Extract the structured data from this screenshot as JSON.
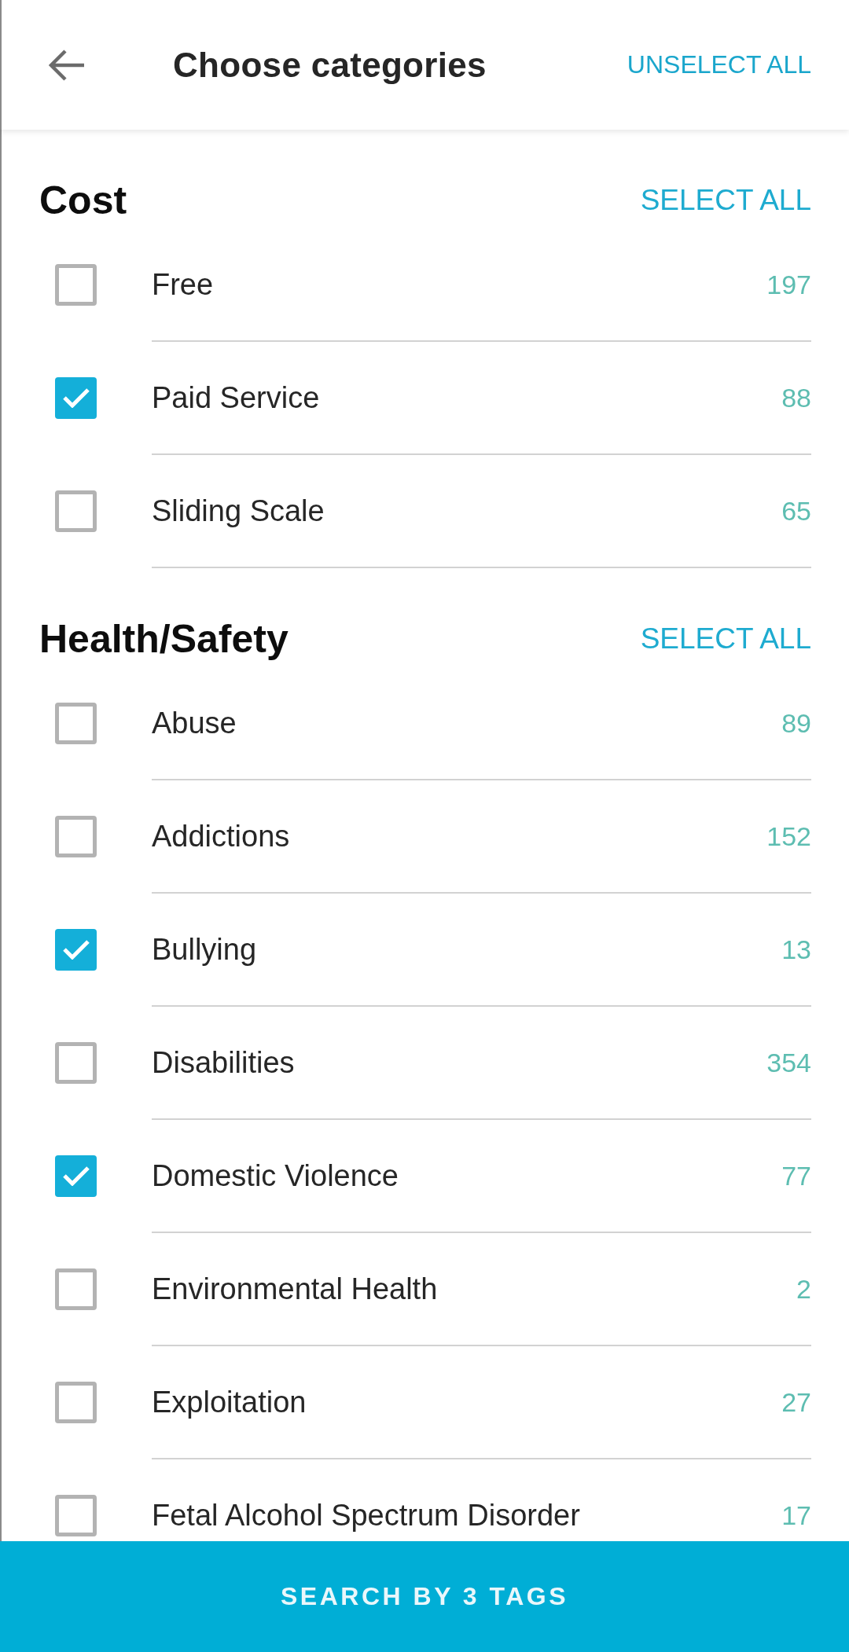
{
  "header": {
    "title": "Choose categories",
    "action": "UNSELECT ALL"
  },
  "sections": [
    {
      "title": "Cost",
      "action": "SELECT ALL",
      "items": [
        {
          "label": "Free",
          "count": "197",
          "checked": false
        },
        {
          "label": "Paid Service",
          "count": "88",
          "checked": true
        },
        {
          "label": "Sliding Scale",
          "count": "65",
          "checked": false
        }
      ]
    },
    {
      "title": "Health/Safety",
      "action": "SELECT ALL",
      "items": [
        {
          "label": "Abuse",
          "count": "89",
          "checked": false
        },
        {
          "label": "Addictions",
          "count": "152",
          "checked": false
        },
        {
          "label": "Bullying",
          "count": "13",
          "checked": true
        },
        {
          "label": "Disabilities",
          "count": "354",
          "checked": false
        },
        {
          "label": "Domestic Violence",
          "count": "77",
          "checked": true
        },
        {
          "label": "Environmental Health",
          "count": "2",
          "checked": false
        },
        {
          "label": "Exploitation",
          "count": "27",
          "checked": false
        },
        {
          "label": "Fetal Alcohol Spectrum Disorder",
          "count": "17",
          "checked": false
        }
      ]
    }
  ],
  "search_button": "SEARCH BY 3 TAGS"
}
